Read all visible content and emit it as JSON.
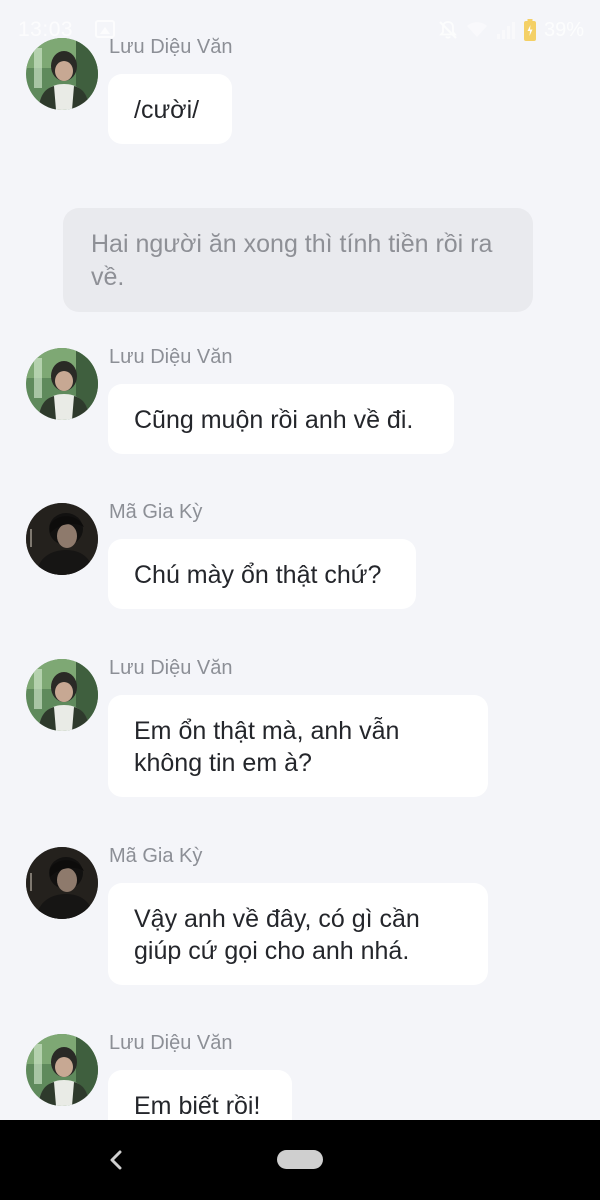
{
  "status_bar": {
    "time": "13:03",
    "battery_percent": "39%",
    "icons": [
      "gallery-icon",
      "bell-off-icon",
      "wifi-icon",
      "signal-icon",
      "battery-charging-icon"
    ]
  },
  "chat": {
    "narration": "Hai người ăn xong thì tính tiền rồi ra về.",
    "messages": [
      {
        "sender": "Lưu Diệu Văn",
        "text": "/cười/",
        "avatar": "avatar-luu-dieu-van"
      },
      {
        "sender": "Lưu Diệu Văn",
        "text": "Cũng muộn rồi anh về đi.",
        "avatar": "avatar-luu-dieu-van"
      },
      {
        "sender": "Mã Gia Kỳ",
        "text": "Chú mày ổn thật chứ?",
        "avatar": "avatar-ma-gia-ky"
      },
      {
        "sender": "Lưu Diệu Văn",
        "text": "Em ổn thật mà, anh vẫn không tin em à?",
        "avatar": "avatar-luu-dieu-van"
      },
      {
        "sender": "Mã Gia Kỳ",
        "text": "Vậy anh về đây, có gì cần giúp cứ gọi cho anh nhá.",
        "avatar": "avatar-ma-gia-ky"
      },
      {
        "sender": "Lưu Diệu Văn",
        "text": "Em biết rồi!",
        "avatar": "avatar-luu-dieu-van"
      }
    ]
  },
  "nav_bar": {
    "icons": [
      "back-icon",
      "home-pill"
    ]
  },
  "colors": {
    "background": "#f4f5f9",
    "bubble": "#ffffff",
    "narration_bg": "#e9eaee",
    "sender_name": "#8c8f96",
    "nav_bar": "#000000"
  }
}
